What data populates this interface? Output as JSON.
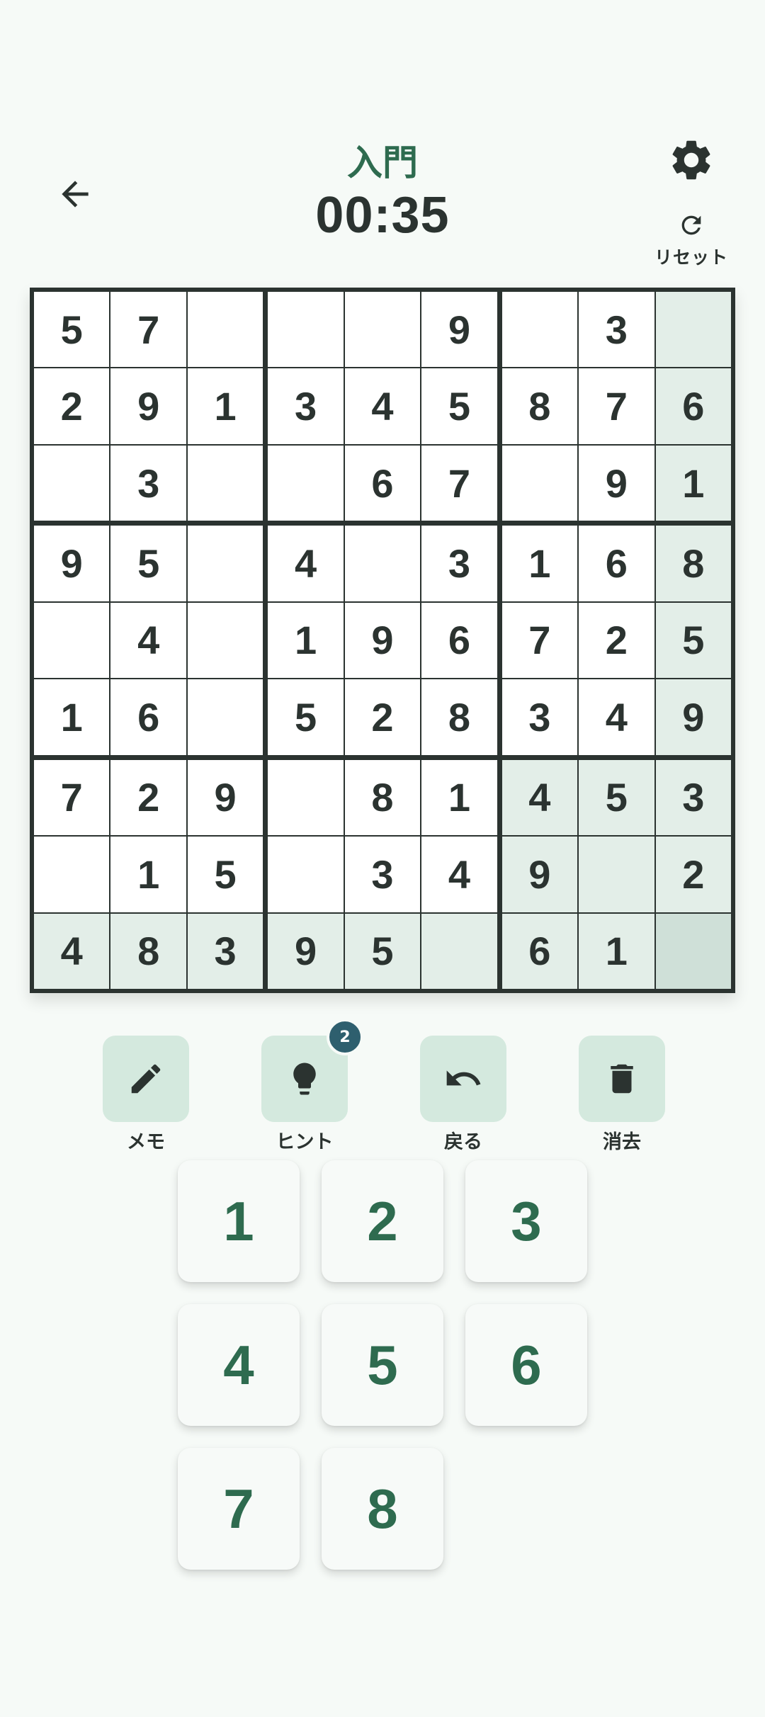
{
  "header": {
    "level": "入門",
    "timer": "00:35",
    "reset_label": "リセット",
    "back_icon": "arrow-left-icon",
    "settings_icon": "gear-icon",
    "reset_icon": "refresh-icon"
  },
  "board": {
    "cells": [
      [
        "5",
        "7",
        "",
        "",
        "",
        "9",
        "",
        "3",
        ""
      ],
      [
        "2",
        "9",
        "1",
        "3",
        "4",
        "5",
        "8",
        "7",
        "6"
      ],
      [
        "",
        "3",
        "",
        "",
        "6",
        "7",
        "",
        "9",
        "1"
      ],
      [
        "9",
        "5",
        "",
        "4",
        "",
        "3",
        "1",
        "6",
        "8"
      ],
      [
        "",
        "4",
        "",
        "1",
        "9",
        "6",
        "7",
        "2",
        "5"
      ],
      [
        "1",
        "6",
        "",
        "5",
        "2",
        "8",
        "3",
        "4",
        "9"
      ],
      [
        "7",
        "2",
        "9",
        "",
        "8",
        "1",
        "4",
        "5",
        "3"
      ],
      [
        "",
        "1",
        "5",
        "",
        "3",
        "4",
        "9",
        "",
        "2"
      ],
      [
        "4",
        "8",
        "3",
        "9",
        "5",
        "",
        "6",
        "1",
        ""
      ]
    ],
    "selected": [
      8,
      8
    ]
  },
  "tools": [
    {
      "label": "メモ",
      "icon": "pencil-icon"
    },
    {
      "label": "ヒント",
      "icon": "lightbulb-icon",
      "badge": "2"
    },
    {
      "label": "戻る",
      "icon": "undo-icon"
    },
    {
      "label": "消去",
      "icon": "trash-icon"
    }
  ],
  "numpad": {
    "keys": [
      "1",
      "2",
      "3",
      "4",
      "5",
      "6",
      "7",
      "8"
    ]
  },
  "colors": {
    "accent": "#2e6b4f",
    "board_border": "#2b3330",
    "highlight": "#e3eee8",
    "selected": "#cfe0d8",
    "tool_bg": "#d4e9de",
    "badge": "#2e5f6e"
  }
}
